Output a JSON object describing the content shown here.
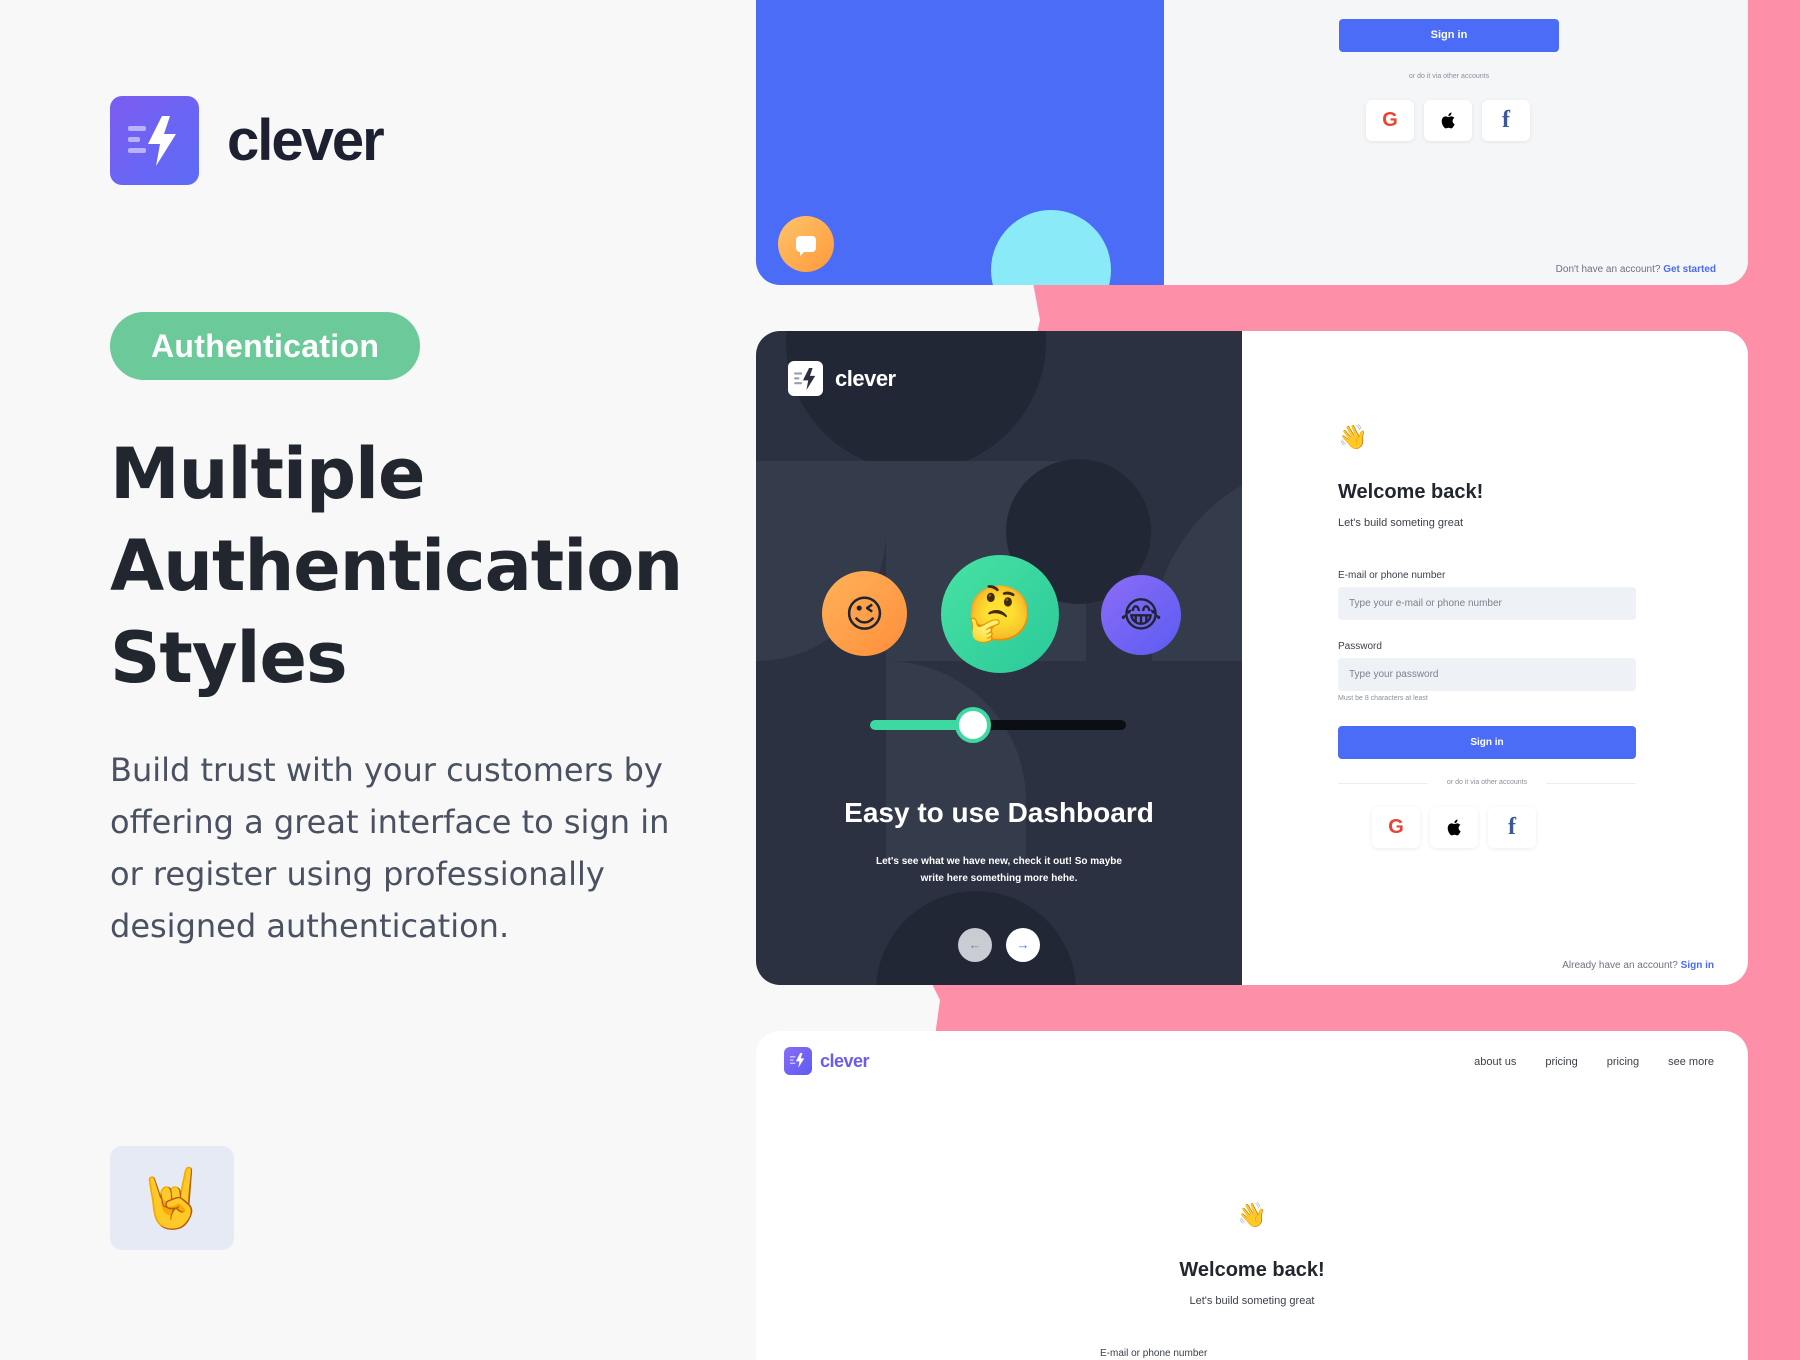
{
  "promo": {
    "brand_name": "clever",
    "tag": "Authentication",
    "headline": [
      "Multiple",
      "Authentication",
      "Styles"
    ],
    "description": "Build trust with your customers by offering a great interface to sign in or register using professionally designed authentication.",
    "badge_icon": "rock-on-hand-icon",
    "badge_glyph": "🤘"
  },
  "colors": {
    "accent": "#4a6cf7",
    "tag_green": "#6cc999",
    "pink": "#fe8fa8",
    "dark_panel": "#2b3140"
  },
  "card1": {
    "signin_label": "Sign in",
    "or_text": "or do it via other accounts",
    "socials": [
      "G",
      "",
      "f"
    ],
    "footer_text": "Don't have an account?",
    "footer_link": "Get started"
  },
  "card2": {
    "brand_name": "clever",
    "emojis": [
      "😉",
      "🤔",
      "😂"
    ],
    "slider_value": 0.4,
    "title": "Easy to use Dashboard",
    "subtitle": "Let's see what we have new, check it out! So maybe write here something more hehe.",
    "prev_arrow": "←",
    "next_arrow": "→",
    "wave": "👋",
    "welcome": "Welcome back!",
    "build_text": "Let's build someting great",
    "email_label": "E-mail or phone number",
    "email_placeholder": "Type your e-mail or phone number",
    "password_label": "Password",
    "password_placeholder": "Type your password",
    "password_hint": "Must be 8 characters at least",
    "signin_label": "Sign in",
    "or_text": "or do it via other accounts",
    "socials": [
      "G",
      "",
      "f"
    ],
    "footer_text": "Already have an account?",
    "footer_link": "Sign in"
  },
  "card3": {
    "brand_name": "clever",
    "nav": [
      "about us",
      "pricing",
      "pricing",
      "see more"
    ],
    "wave": "👋",
    "welcome": "Welcome back!",
    "build_text": "Let's build someting great",
    "email_label": "E-mail or phone number"
  }
}
